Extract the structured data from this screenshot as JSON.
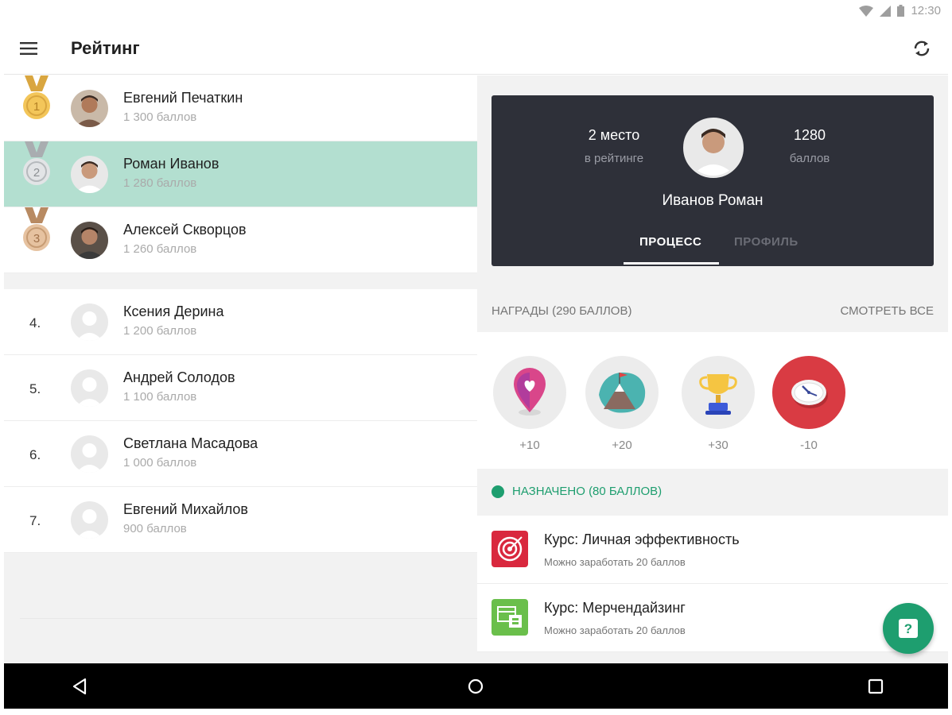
{
  "status_bar": {
    "time": "12:30",
    "icons": [
      "wifi-icon",
      "signal-icon",
      "battery-icon"
    ]
  },
  "app_bar": {
    "title": "Рейтинг",
    "menu_icon": "menu-icon",
    "refresh_icon": "refresh-icon"
  },
  "leaderboard": {
    "top": [
      {
        "place": "1",
        "name": "Евгений Печаткин",
        "score": "1 300 баллов",
        "medal": "gold",
        "selected": false
      },
      {
        "place": "2",
        "name": "Роман Иванов",
        "score": "1 280 баллов",
        "medal": "silver",
        "selected": true
      },
      {
        "place": "3",
        "name": "Алексей Скворцов",
        "score": "1 260 баллов",
        "medal": "bronze",
        "selected": false
      }
    ],
    "rest": [
      {
        "place": "4.",
        "name": "Ксения Дерина",
        "score": "1 200 баллов"
      },
      {
        "place": "5.",
        "name": "Андрей Солодов",
        "score": "1 100 баллов"
      },
      {
        "place": "6.",
        "name": "Светлана Масадова",
        "score": "1 000 баллов"
      },
      {
        "place": "7.",
        "name": "Евгений Михайлов",
        "score": "900 баллов"
      }
    ]
  },
  "profile": {
    "place_value": "2 место",
    "place_caption": "в рейтинге",
    "points_value": "1280",
    "points_caption": "баллов",
    "name": "Иванов Роман",
    "tabs": {
      "process": "ПРОЦЕСС",
      "profile": "ПРОФИЛЬ"
    },
    "active_tab": "process"
  },
  "awards": {
    "header": "НАГРАДЫ (290 БАЛЛОВ)",
    "see_all": "СМОТРЕТЬ ВСЕ",
    "items": [
      {
        "icon": "heart-pin-icon",
        "points": "+10"
      },
      {
        "icon": "mountain-flag-icon",
        "points": "+20"
      },
      {
        "icon": "trophy-icon",
        "points": "+30"
      },
      {
        "icon": "clock-icon",
        "points": "-10"
      }
    ]
  },
  "assigned": {
    "label": "НАЗНАЧЕНО (80 БАЛЛОВ)",
    "courses": [
      {
        "title": "Курс: Личная эффективность",
        "subtitle": "Можно заработать 20 баллов",
        "icon": "target-icon"
      },
      {
        "title": "Курс: Мерчендайзинг",
        "subtitle": "Можно заработать 20 баллов",
        "icon": "merch-icon"
      }
    ]
  },
  "fab": {
    "icon": "help-icon",
    "label": "?"
  },
  "colors": {
    "accent": "#1e9e6f",
    "selected_row": "#b3dfd0",
    "card": "#2e3039"
  }
}
